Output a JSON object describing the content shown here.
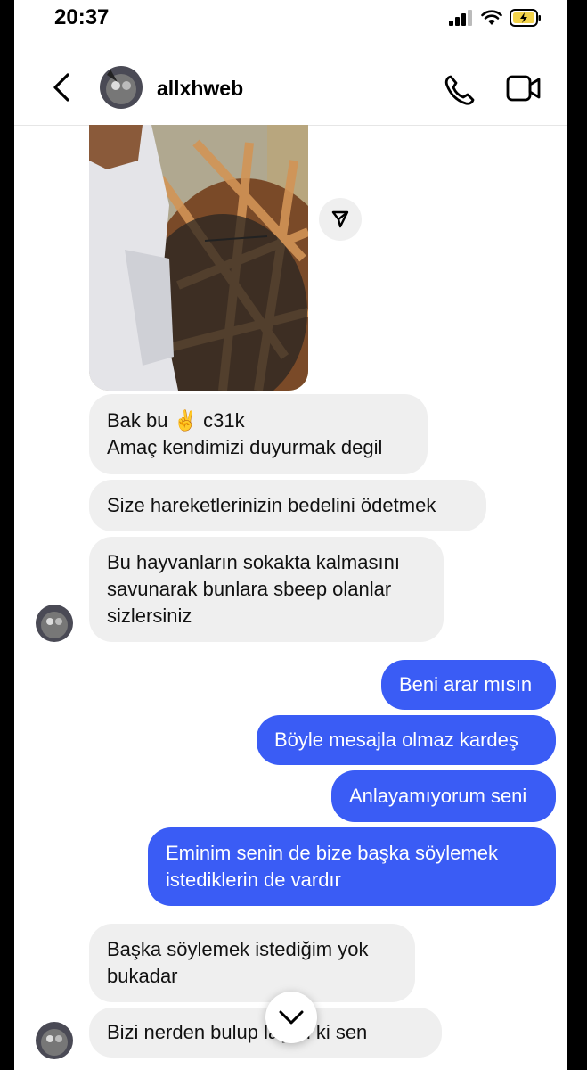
{
  "status_bar": {
    "time": "20:37"
  },
  "header": {
    "username": "allxhweb"
  },
  "messages_in_1": {
    "line1": "Bak bu ✌️ c31k",
    "line2": "Amaç kendimizi duyurmak degil"
  },
  "messages_in_2": {
    "text": "Size hareketlerinizin bedelini ödetmek"
  },
  "messages_in_3": {
    "line1": "Bu hayvanların sokakta kalmasını",
    "line2": "savunarak bunlara sbeep olanlar",
    "line3": "sizlersiniz"
  },
  "messages_out": [
    {
      "text": "Beni arar mısın"
    },
    {
      "text": "Böyle mesajla olmaz kardeş"
    },
    {
      "text": "Anlayamıyorum seni"
    },
    {
      "line1": "Eminim senin de bize  başka söylemek",
      "line2": "istediklerin de vardır"
    }
  ],
  "messages_in_4": {
    "line1": "Başka söylemek istediğim yok",
    "line2": "bukadar"
  },
  "messages_in_5": {
    "text": "Bizi nerden bulup    laştın ki sen"
  },
  "icons": {
    "back": "chevron-left-icon",
    "call": "phone-icon",
    "video": "video-camera-icon",
    "share": "send-icon",
    "scroll": "chevron-down-icon"
  },
  "colors": {
    "outgoing": "#3a5cf5",
    "incoming": "#efefef",
    "battery": "#f3d34a"
  }
}
